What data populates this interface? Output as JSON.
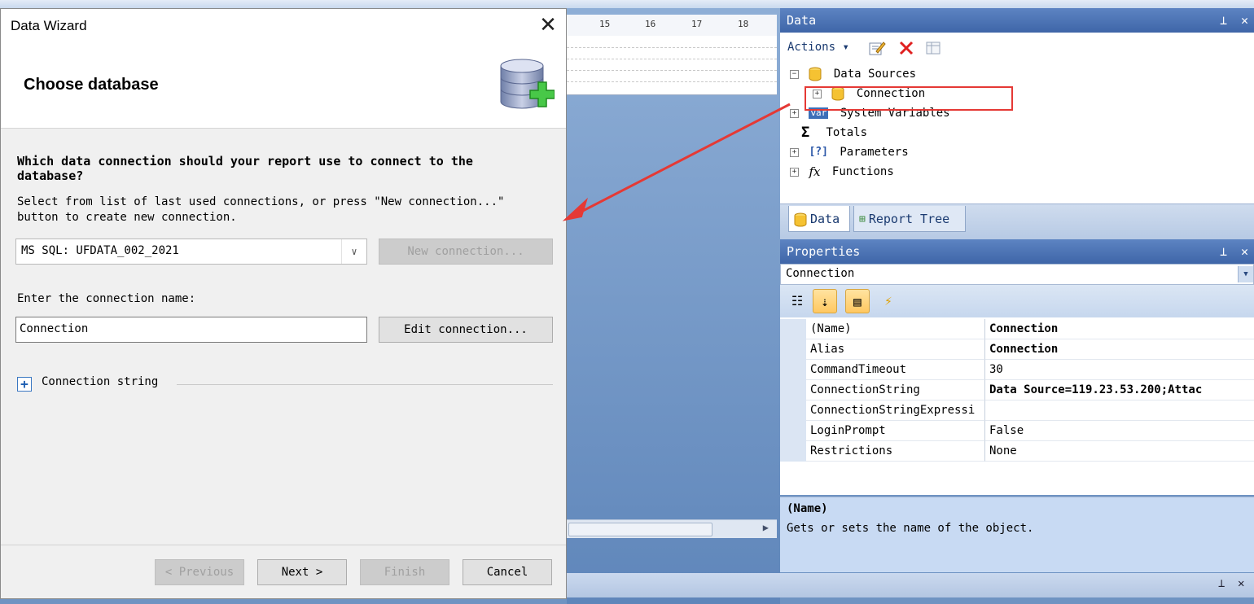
{
  "dialog": {
    "title": "Data Wizard",
    "close_glyph": "✕",
    "heading": "Choose database",
    "question": "Which data connection should your report use to connect to the database?",
    "instructions": "Select from list of last used connections, or press \"New connection...\" button to create new connection.",
    "connection_select": {
      "value": "MS SQL: UFDATA_002_2021"
    },
    "new_connection_label": "New connection...",
    "name_label": "Enter the connection name:",
    "name_value": "Connection",
    "edit_connection_label": "Edit connection...",
    "connection_string_label": "Connection string",
    "buttons": {
      "previous": "< Previous",
      "next": "Next >",
      "finish": "Finish",
      "cancel": "Cancel"
    }
  },
  "designer": {
    "ruler_ticks": [
      "15",
      "16",
      "17",
      "18"
    ]
  },
  "data_panel": {
    "title": "Data",
    "pin": "📌",
    "close": "✕",
    "actions_label": "Actions",
    "tree": [
      {
        "label": "Data Sources",
        "icon": "database-icon",
        "expander": "−"
      },
      {
        "label": "Connection",
        "icon": "database-icon",
        "expander": "+"
      },
      {
        "label": "System Variables",
        "icon": "variable-icon",
        "expander": "+"
      },
      {
        "label": "Totals",
        "icon": "sigma-icon"
      },
      {
        "label": "Parameters",
        "icon": "parameters-icon",
        "expander": "+"
      },
      {
        "label": "Functions",
        "icon": "function-icon",
        "expander": "+"
      }
    ],
    "tabs": [
      "Data",
      "Report Tree"
    ]
  },
  "properties_panel": {
    "title": "Properties",
    "object": "Connection",
    "rows": [
      {
        "name": "(Name)",
        "value": "Connection",
        "bold": true
      },
      {
        "name": "Alias",
        "value": "Connection",
        "bold": true
      },
      {
        "name": "CommandTimeout",
        "value": "30",
        "bold": false
      },
      {
        "name": "ConnectionString",
        "value": "Data Source=119.23.53.200;Attac",
        "bold": true
      },
      {
        "name": "ConnectionStringExpressi",
        "value": "",
        "bold": false
      },
      {
        "name": "LoginPrompt",
        "value": "False",
        "bold": false
      },
      {
        "name": "Restrictions",
        "value": "None",
        "bold": false
      }
    ],
    "description_title": "(Name)",
    "description_text": "Gets or sets the name of the object."
  },
  "colors": {
    "accent": "#3f66a8",
    "highlight": "#e53935"
  }
}
